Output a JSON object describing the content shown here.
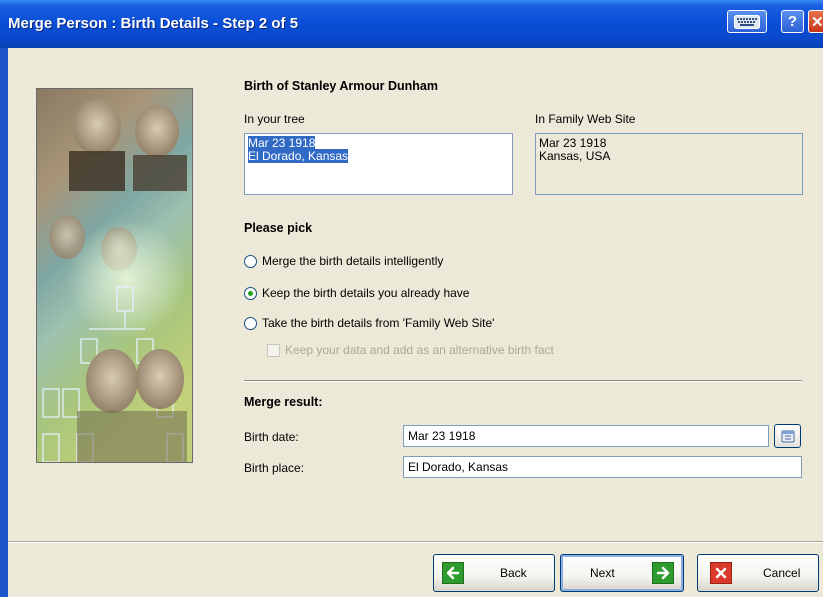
{
  "window": {
    "title": "Merge Person : Birth Details - Step 2 of 5"
  },
  "compare": {
    "heading": "Birth of Stanley Armour Dunham",
    "tree_label": "In your tree",
    "tree_date": "Mar 23 1918",
    "tree_place": "El Dorado, Kansas",
    "web_label": "In Family Web Site",
    "web_date": "Mar 23 1918",
    "web_place": "Kansas, USA"
  },
  "pick": {
    "heading": "Please pick",
    "options": [
      {
        "label": "Merge the birth details intelligently",
        "selected": false
      },
      {
        "label": "Keep the birth details you already have",
        "selected": true
      },
      {
        "label": "Take the birth details from 'Family Web Site'",
        "selected": false
      }
    ],
    "alt_fact_label": "Keep your data and add as an alternative birth fact"
  },
  "result": {
    "heading": "Merge result:",
    "date_label": "Birth date:",
    "date_value": "Mar 23 1918",
    "place_label": "Birth place:",
    "place_value": "El Dorado, Kansas"
  },
  "buttons": {
    "back": "Back",
    "next": "Next",
    "cancel": "Cancel"
  },
  "colors": {
    "title_bar": "#0a4fd8",
    "selection": "#316ac5",
    "back_icon": "#2e9b2e",
    "cancel_icon": "#d9382a"
  }
}
